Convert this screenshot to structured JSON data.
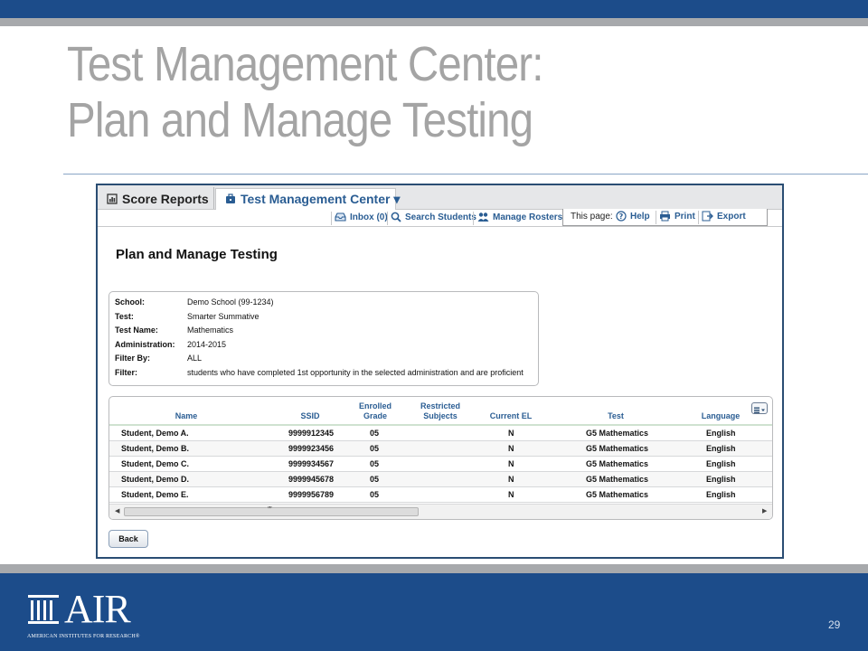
{
  "slide": {
    "title_line1": "Test Management Center:",
    "title_line2": "Plan and Manage Testing",
    "page_number": "29",
    "logo_text": "AIR",
    "logo_subtitle": "AMERICAN INSTITUTES FOR RESEARCH®",
    "colors": {
      "band": "#1c4c8a",
      "gray_rule": "#a7a9ac",
      "title": "#a4a4a4",
      "link": "#2a5d93"
    }
  },
  "app": {
    "tabs": [
      {
        "label": "Score Reports",
        "icon": "report-icon"
      },
      {
        "label": "Test Management Center ▾",
        "icon": "briefcase-icon"
      }
    ],
    "toolbar": {
      "inbox": "Inbox (0)",
      "search_students": "Search Students",
      "manage_rosters": "Manage Rosters",
      "this_page": "This page:",
      "help": "Help",
      "print": "Print",
      "export": "Export"
    },
    "page_heading": "Plan and Manage Testing",
    "info": [
      {
        "label": "School:",
        "value": "Demo School (99-1234)"
      },
      {
        "label": "Test:",
        "value": "Smarter Summative"
      },
      {
        "label": "Test Name:",
        "value": "Mathematics"
      },
      {
        "label": "Administration:",
        "value": "2014-2015"
      },
      {
        "label": "Filter By:",
        "value": "ALL"
      },
      {
        "label": "Filter:",
        "value": "students who have completed 1st opportunity in the selected administration and are proficient"
      }
    ],
    "grid": {
      "columns": {
        "name": "Name",
        "ssid": "SSID",
        "grade_1": "Enrolled",
        "grade_2": "Grade",
        "restricted_1": "Restricted",
        "restricted_2": "Subjects",
        "current_el": "Current EL",
        "test": "Test",
        "language": "Language"
      },
      "rows": [
        {
          "name": "Student, Demo A.",
          "ssid": "9999912345",
          "grade": "05",
          "restricted": "",
          "current_el": "N",
          "test": "G5 Mathematics",
          "language": "English"
        },
        {
          "name": "Student, Demo B.",
          "ssid": "9999923456",
          "grade": "05",
          "restricted": "",
          "current_el": "N",
          "test": "G5 Mathematics",
          "language": "English"
        },
        {
          "name": "Student, Demo C.",
          "ssid": "9999934567",
          "grade": "05",
          "restricted": "",
          "current_el": "N",
          "test": "G5 Mathematics",
          "language": "English"
        },
        {
          "name": "Student, Demo D.",
          "ssid": "9999945678",
          "grade": "05",
          "restricted": "",
          "current_el": "N",
          "test": "G5 Mathematics",
          "language": "English"
        },
        {
          "name": "Student, Demo E.",
          "ssid": "9999956789",
          "grade": "05",
          "restricted": "",
          "current_el": "N",
          "test": "G5 Mathematics",
          "language": "English"
        }
      ],
      "scroll_grip": "″″"
    },
    "back_button": "Back"
  }
}
